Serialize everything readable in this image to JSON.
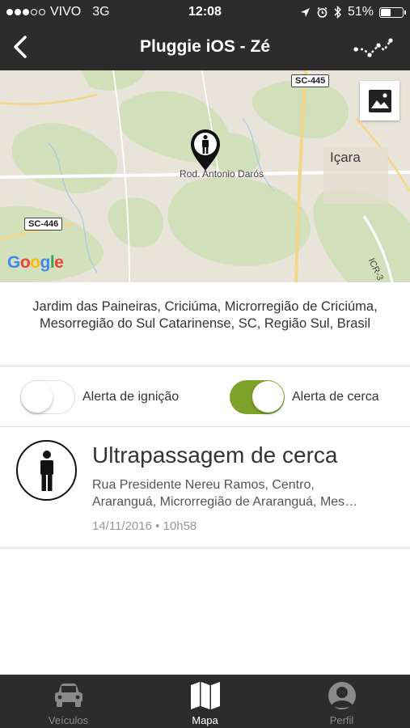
{
  "status_bar": {
    "carrier": "VIVO",
    "network": "3G",
    "time": "12:08",
    "battery": "51%",
    "battery_level": 0.51,
    "signal_bars": 3,
    "icons": [
      "location-arrow-icon",
      "alarm-icon",
      "bluetooth-icon",
      "battery-icon"
    ]
  },
  "nav": {
    "title": "Pluggie iOS - Zé",
    "back_icon": "chevron-left-icon",
    "logo_icon": "pluggie-logo-icon"
  },
  "map": {
    "shields": [
      "SC-445",
      "SC-446"
    ],
    "town": "Içara",
    "road": "Rod. Antonio Darós",
    "side_road": "ICR-3",
    "attribution": "Google",
    "toggle_icon": "image-icon",
    "pin_icon": "person-pin-icon"
  },
  "address": {
    "text": "Jardim das Paineiras, Criciúma, Microrregião de Criciúma, Mesorregião do Sul Catarinense, SC, Região Sul, Brasil"
  },
  "alerts": {
    "ignition": {
      "label": "Alerta de ignição",
      "enabled": false
    },
    "fence": {
      "label": "Alerta de cerca",
      "enabled": true
    },
    "accent_color": "#7ea229"
  },
  "event": {
    "title": "Ultrapassagem de cerca",
    "address_line1": "Rua Presidente Nereu Ramos, Centro,",
    "address_line2": "Araranguá, Microrregião de Araranguá, Mes…",
    "timestamp": "14/11/2016 • 10h58",
    "icon": "person-icon"
  },
  "tabs": [
    {
      "label": "Veículos",
      "icon": "car-icon",
      "active": false
    },
    {
      "label": "Mapa",
      "icon": "map-icon",
      "active": true
    },
    {
      "label": "Perfil",
      "icon": "profile-icon",
      "active": false
    }
  ]
}
